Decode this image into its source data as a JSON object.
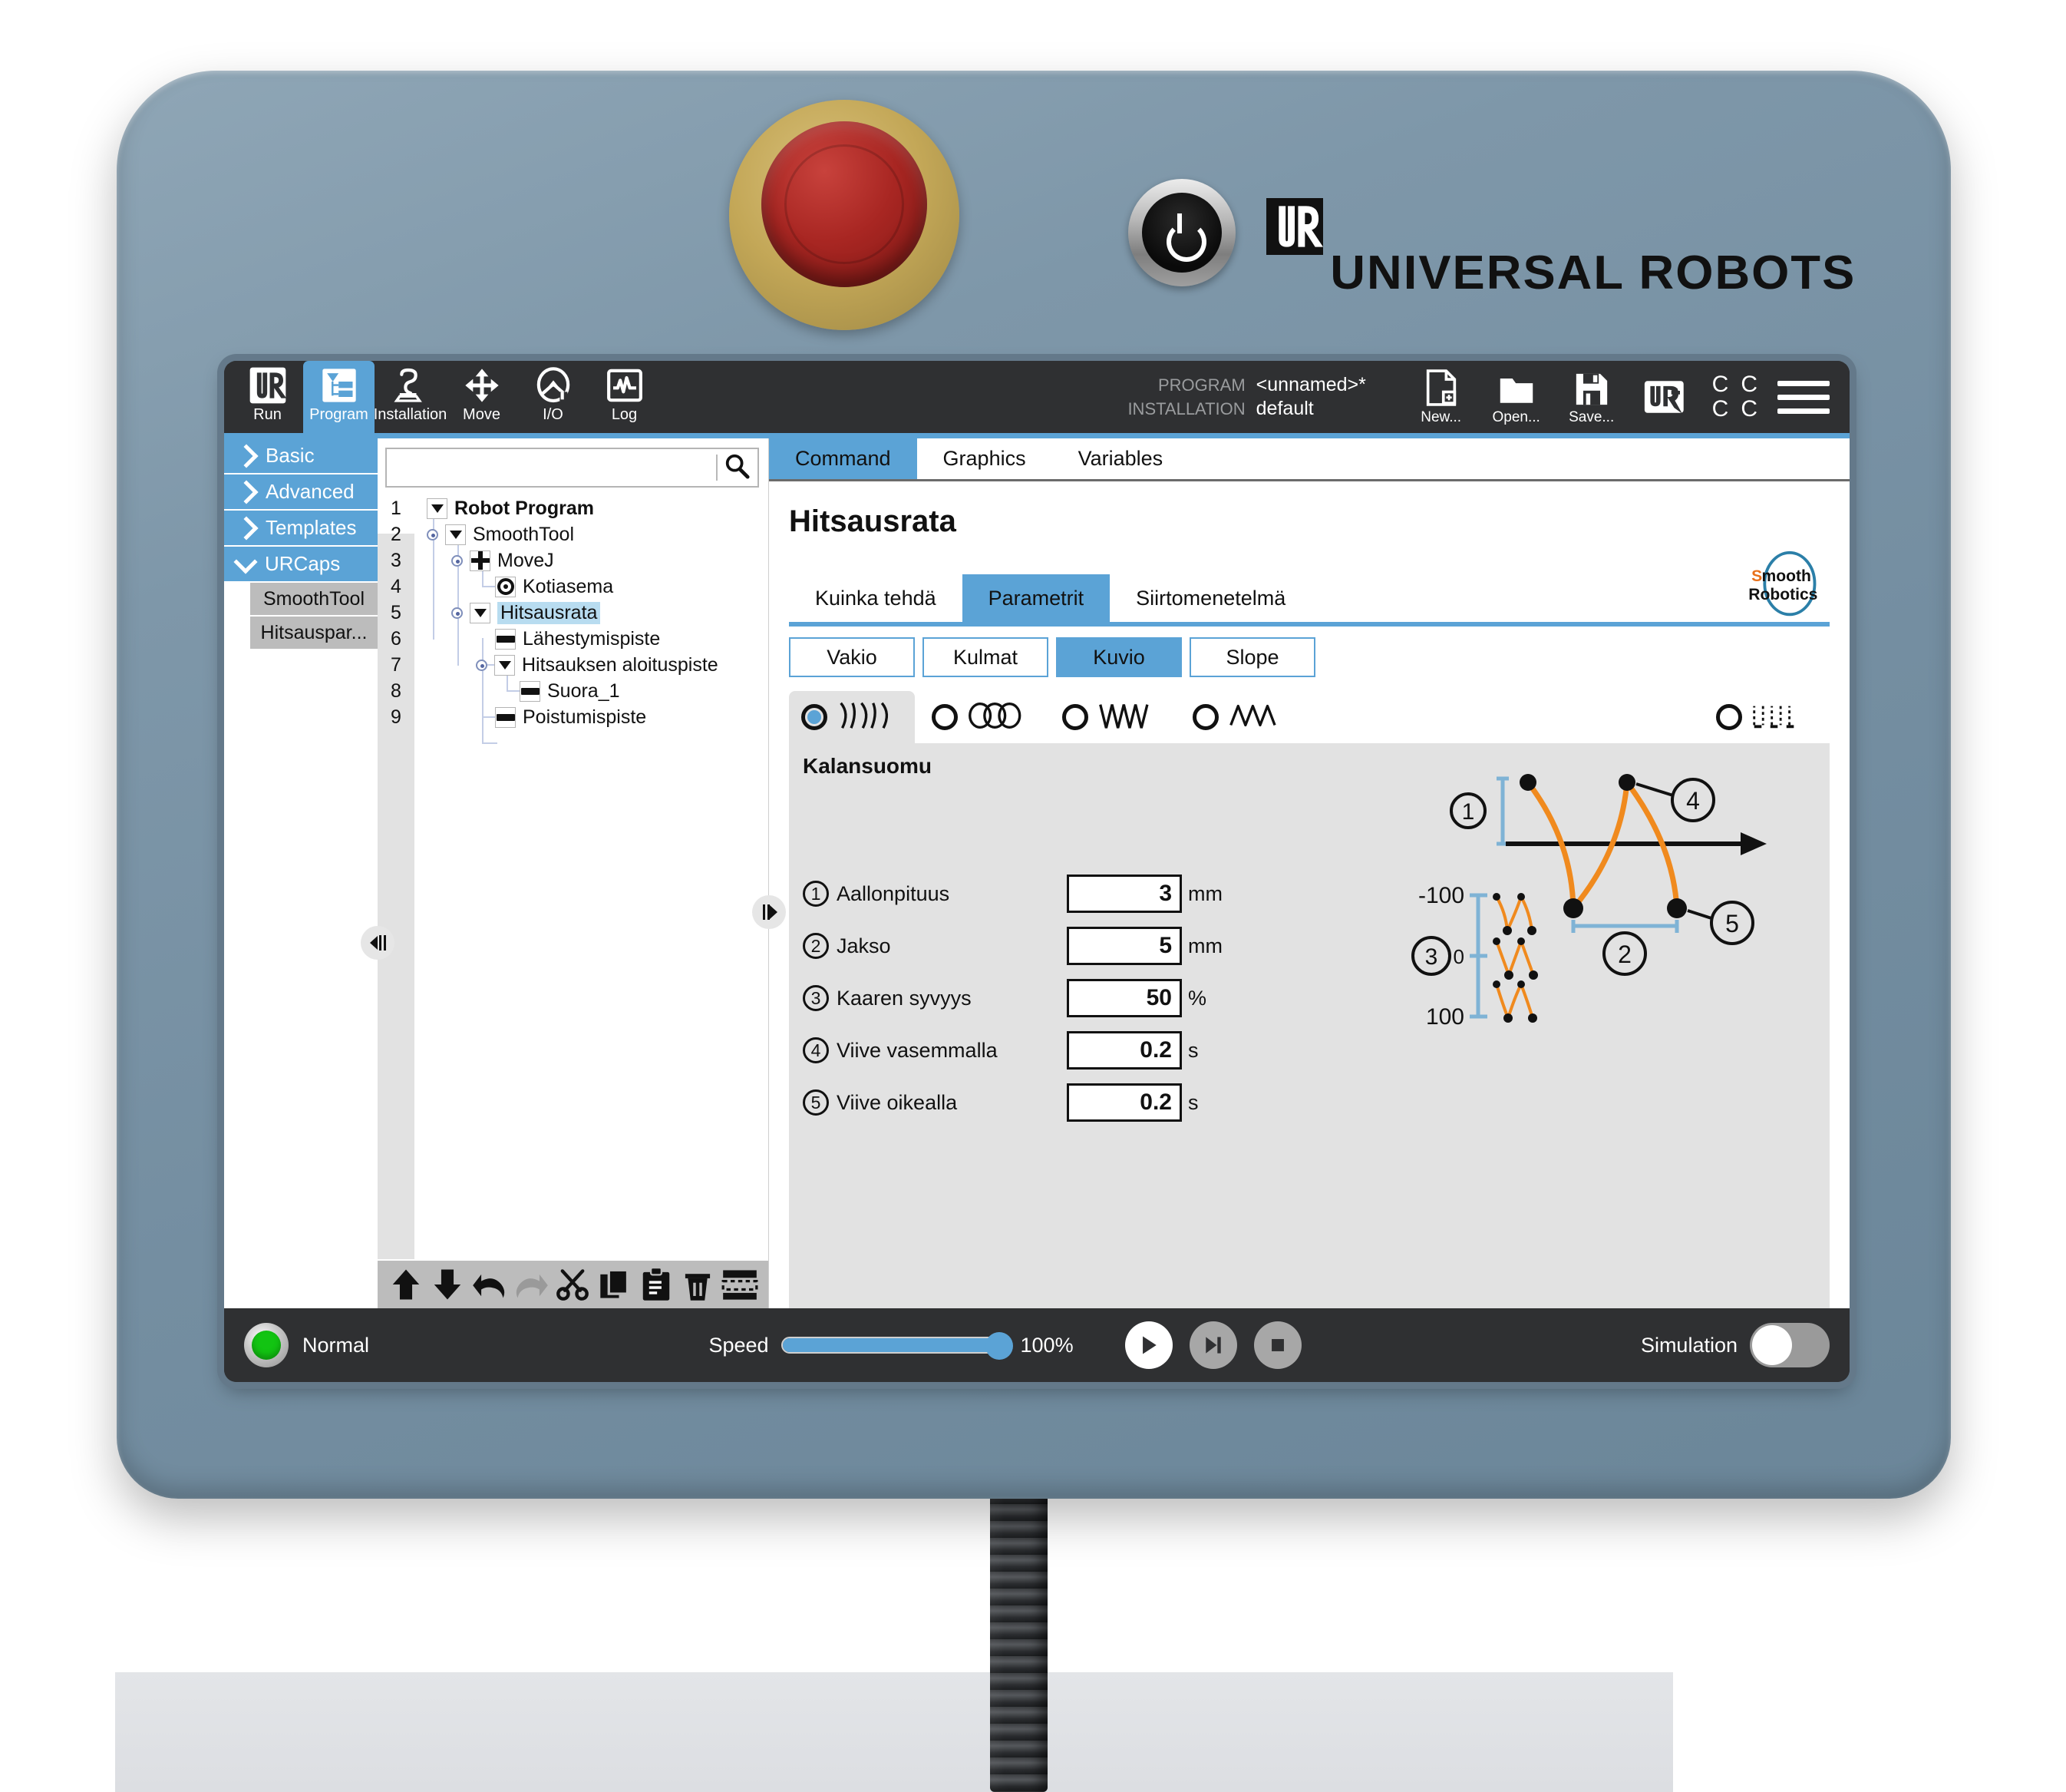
{
  "brand": {
    "wordmark": "UNIVERSAL ROBOTS",
    "logo_icon": "ur-logo-icon",
    "power_icon": "power-icon",
    "estop_icon": "emergency-stop-icon"
  },
  "header": {
    "tabs": [
      {
        "label": "Run",
        "icon": "ur-logo-icon",
        "active": false
      },
      {
        "label": "Program",
        "icon": "program-tree-icon",
        "active": true
      },
      {
        "label": "Installation",
        "icon": "robot-arm-icon",
        "active": false
      },
      {
        "label": "Move",
        "icon": "move-arrows-icon",
        "active": false
      },
      {
        "label": "I/O",
        "icon": "io-loop-icon",
        "active": false
      },
      {
        "label": "Log",
        "icon": "log-waveform-icon",
        "active": false
      }
    ],
    "program_key": "PROGRAM",
    "program_value": "<unnamed>*",
    "installation_key": "INSTALLATION",
    "installation_value": "default",
    "file_buttons": [
      {
        "label": "New...",
        "icon": "new-file-icon"
      },
      {
        "label": "Open...",
        "icon": "open-folder-icon"
      },
      {
        "label": "Save...",
        "icon": "save-disk-icon"
      }
    ],
    "urplus_label": "UR+",
    "status_letters": [
      "C",
      "C",
      "C",
      "C"
    ],
    "menu_icon": "hamburger-menu-icon",
    "accent_color": "#5ba3d6"
  },
  "structure": {
    "items": [
      {
        "label": "Basic",
        "expanded": false
      },
      {
        "label": "Advanced",
        "expanded": false
      },
      {
        "label": "Templates",
        "expanded": false
      },
      {
        "label": "URCaps",
        "expanded": true
      }
    ],
    "urcaps": [
      {
        "label": "SmoothTool"
      },
      {
        "label": "Hitsauspar..."
      }
    ]
  },
  "search": {
    "value": "",
    "placeholder": "",
    "icon": "search-icon"
  },
  "tree": {
    "rows": [
      {
        "num": "1",
        "label": "Robot Program",
        "indent": 0,
        "icon": "triangle",
        "bold": true,
        "selected": false
      },
      {
        "num": "2",
        "label": "SmoothTool",
        "indent": 1,
        "icon": "triangle",
        "bold": false,
        "selected": false
      },
      {
        "num": "3",
        "label": "MoveJ",
        "indent": 2,
        "icon": "move",
        "bold": false,
        "selected": false
      },
      {
        "num": "4",
        "label": "Kotiasema",
        "indent": 3,
        "icon": "waypoint",
        "bold": false,
        "selected": false
      },
      {
        "num": "5",
        "label": "Hitsausrata",
        "indent": 2,
        "icon": "triangle",
        "bold": false,
        "selected": true
      },
      {
        "num": "6",
        "label": "Lähestymispiste",
        "indent": 3,
        "icon": "dash",
        "bold": false,
        "selected": false
      },
      {
        "num": "7",
        "label": "Hitsauksen aloituspiste",
        "indent": 3,
        "icon": "triangle",
        "bold": false,
        "selected": false
      },
      {
        "num": "8",
        "label": "Suora_1",
        "indent": 4,
        "icon": "dash",
        "bold": false,
        "selected": false
      },
      {
        "num": "9",
        "label": "Poistumispiste",
        "indent": 3,
        "icon": "dash",
        "bold": false,
        "selected": false
      }
    ]
  },
  "edit_tools": [
    {
      "name": "move-up",
      "icon": "arrow-up-icon"
    },
    {
      "name": "move-down",
      "icon": "arrow-down-icon"
    },
    {
      "name": "undo",
      "icon": "undo-icon"
    },
    {
      "name": "redo",
      "icon": "redo-icon"
    },
    {
      "name": "cut",
      "icon": "scissors-icon"
    },
    {
      "name": "copy",
      "icon": "copy-icon"
    },
    {
      "name": "paste",
      "icon": "clipboard-icon"
    },
    {
      "name": "delete",
      "icon": "trash-icon"
    },
    {
      "name": "suppress",
      "icon": "suppress-icon"
    }
  ],
  "right_panel": {
    "tabs": [
      {
        "label": "Command",
        "active": true
      },
      {
        "label": "Graphics",
        "active": false
      },
      {
        "label": "Variables",
        "active": false
      }
    ],
    "title": "Hitsausrata",
    "subtabs": [
      {
        "label": "Kuinka tehdä",
        "active": false
      },
      {
        "label": "Parametrit",
        "active": true
      },
      {
        "label": "Siirtomenetelmä",
        "active": false
      }
    ],
    "logo": {
      "line1": "Smooth",
      "line2": "Robotics",
      "accent": "#e8701a"
    },
    "mode_buttons": [
      {
        "label": "Vakio",
        "active": false
      },
      {
        "label": "Kulmat",
        "active": false
      },
      {
        "label": "Kuvio",
        "active": true
      },
      {
        "label": "Slope",
        "active": false
      }
    ],
    "patterns": [
      {
        "name": "fishscale-pattern",
        "icon": "weave-fishscale-icon",
        "selected": true
      },
      {
        "name": "circular-pattern",
        "icon": "weave-circles-icon",
        "selected": false
      },
      {
        "name": "zigzag-pattern",
        "icon": "weave-zigzag-icon",
        "selected": false
      },
      {
        "name": "sine-pattern",
        "icon": "weave-sine-icon",
        "selected": false
      },
      {
        "name": "square-pattern",
        "icon": "weave-square-icon",
        "selected": false
      }
    ],
    "panel_title": "Kalansuomu",
    "parameters": [
      {
        "num": "1",
        "label": "Aallonpituus",
        "value": "3",
        "unit": "mm"
      },
      {
        "num": "2",
        "label": "Jakso",
        "value": "5",
        "unit": "mm"
      },
      {
        "num": "3",
        "label": "Kaaren syvyys",
        "value": "50",
        "unit": "%"
      },
      {
        "num": "4",
        "label": "Viive vasemmalla",
        "value": "0.2",
        "unit": "s"
      },
      {
        "num": "5",
        "label": "Viive oikealla",
        "value": "0.2",
        "unit": "s"
      }
    ],
    "diagram": {
      "callouts": [
        "1",
        "2",
        "3",
        "4",
        "5"
      ],
      "axis_labels": [
        "-100",
        "0",
        "100"
      ],
      "curve_color": "#f08a1e",
      "measure_color": "#7fb3d5"
    }
  },
  "footer": {
    "status": "Normal",
    "status_color": "#12c412",
    "speed_label": "Speed",
    "speed_value": "100%",
    "speed_percent": 100,
    "transport": [
      {
        "name": "play-button",
        "icon": "play-icon"
      },
      {
        "name": "step-button",
        "icon": "step-icon"
      },
      {
        "name": "stop-button",
        "icon": "stop-icon"
      }
    ],
    "simulation_label": "Simulation",
    "simulation_on": false
  }
}
